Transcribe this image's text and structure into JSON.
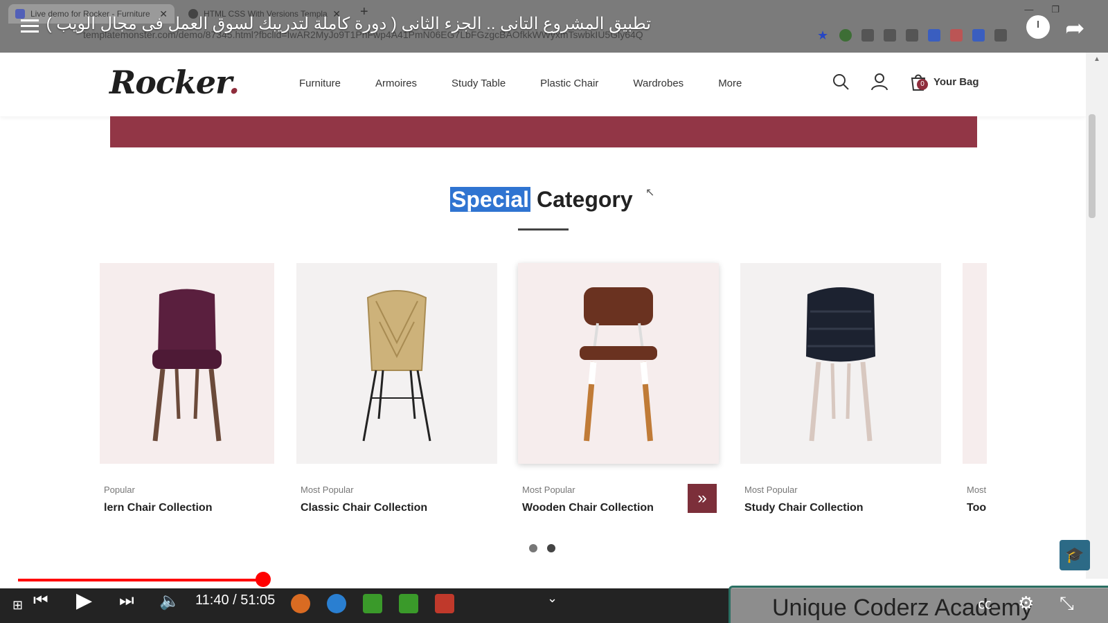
{
  "browser": {
    "tabs": [
      {
        "title": "Live demo for Rocker - Furniture"
      },
      {
        "title": "HTML CSS With Versions Templa"
      }
    ],
    "address": "templatemonster.com/demo/87345.html?fbclid=IwAR2MyJo9T1PhFwp4A41PmN06EG7LbFGzgcBAOfkkWWyxmTswbkIU5Gly64Q"
  },
  "video": {
    "title": "تطبيق المشروع التانى .. الجزء الثانى ( دورة كاملة لتدريبك لسوق العمل فى مجال الويب )",
    "current_time": "11:40",
    "duration": "51:05",
    "time_display": "11:40 / 51:05",
    "progress_fraction": 0.229,
    "watermark": "Unique Coderz Academy"
  },
  "site": {
    "logo": "Rocker",
    "nav": [
      "Furniture",
      "Armoires",
      "Study Table",
      "Plastic Chair",
      "Wardrobes",
      "More"
    ],
    "bag_count": "0",
    "bag_label": "Your Bag",
    "section": {
      "title_highlight": "Special",
      "title_rest": "Category"
    },
    "products": [
      {
        "category": "Popular",
        "name": "lern Chair Collection"
      },
      {
        "category": "Most Popular",
        "name": "Classic Chair Collection"
      },
      {
        "category": "Most Popular",
        "name": "Wooden Chair Collection"
      },
      {
        "category": "Most Popular",
        "name": "Study Chair Collection"
      },
      {
        "category": "Most",
        "name": "Tool"
      }
    ],
    "next_glyph": "»"
  },
  "colors": {
    "brand": "#8f2d3c",
    "banner": "#923646",
    "highlight": "#2f74d1",
    "progress": "#ff0000"
  },
  "icons": [
    "menu-icon",
    "search-icon",
    "user-icon",
    "bag-icon",
    "clock-icon",
    "share-icon",
    "play-icon",
    "settings-icon"
  ]
}
